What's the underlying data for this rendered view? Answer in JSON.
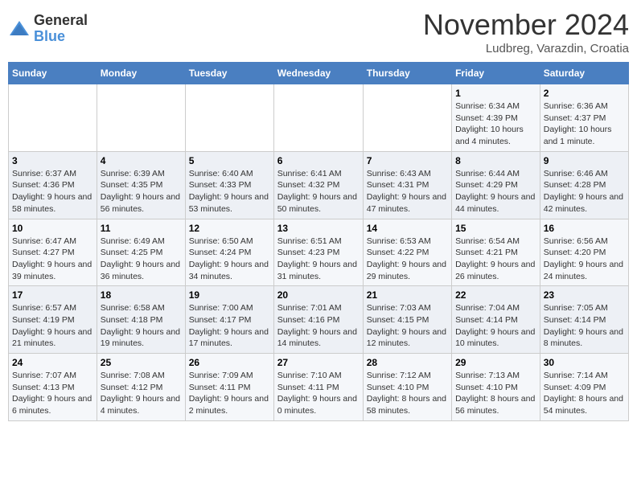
{
  "logo": {
    "general": "General",
    "blue": "Blue"
  },
  "title": "November 2024",
  "location": "Ludbreg, Varazdin, Croatia",
  "days_header": [
    "Sunday",
    "Monday",
    "Tuesday",
    "Wednesday",
    "Thursday",
    "Friday",
    "Saturday"
  ],
  "weeks": [
    [
      {
        "day": "",
        "detail": ""
      },
      {
        "day": "",
        "detail": ""
      },
      {
        "day": "",
        "detail": ""
      },
      {
        "day": "",
        "detail": ""
      },
      {
        "day": "",
        "detail": ""
      },
      {
        "day": "1",
        "detail": "Sunrise: 6:34 AM\nSunset: 4:39 PM\nDaylight: 10 hours and 4 minutes."
      },
      {
        "day": "2",
        "detail": "Sunrise: 6:36 AM\nSunset: 4:37 PM\nDaylight: 10 hours and 1 minute."
      }
    ],
    [
      {
        "day": "3",
        "detail": "Sunrise: 6:37 AM\nSunset: 4:36 PM\nDaylight: 9 hours and 58 minutes."
      },
      {
        "day": "4",
        "detail": "Sunrise: 6:39 AM\nSunset: 4:35 PM\nDaylight: 9 hours and 56 minutes."
      },
      {
        "day": "5",
        "detail": "Sunrise: 6:40 AM\nSunset: 4:33 PM\nDaylight: 9 hours and 53 minutes."
      },
      {
        "day": "6",
        "detail": "Sunrise: 6:41 AM\nSunset: 4:32 PM\nDaylight: 9 hours and 50 minutes."
      },
      {
        "day": "7",
        "detail": "Sunrise: 6:43 AM\nSunset: 4:31 PM\nDaylight: 9 hours and 47 minutes."
      },
      {
        "day": "8",
        "detail": "Sunrise: 6:44 AM\nSunset: 4:29 PM\nDaylight: 9 hours and 44 minutes."
      },
      {
        "day": "9",
        "detail": "Sunrise: 6:46 AM\nSunset: 4:28 PM\nDaylight: 9 hours and 42 minutes."
      }
    ],
    [
      {
        "day": "10",
        "detail": "Sunrise: 6:47 AM\nSunset: 4:27 PM\nDaylight: 9 hours and 39 minutes."
      },
      {
        "day": "11",
        "detail": "Sunrise: 6:49 AM\nSunset: 4:25 PM\nDaylight: 9 hours and 36 minutes."
      },
      {
        "day": "12",
        "detail": "Sunrise: 6:50 AM\nSunset: 4:24 PM\nDaylight: 9 hours and 34 minutes."
      },
      {
        "day": "13",
        "detail": "Sunrise: 6:51 AM\nSunset: 4:23 PM\nDaylight: 9 hours and 31 minutes."
      },
      {
        "day": "14",
        "detail": "Sunrise: 6:53 AM\nSunset: 4:22 PM\nDaylight: 9 hours and 29 minutes."
      },
      {
        "day": "15",
        "detail": "Sunrise: 6:54 AM\nSunset: 4:21 PM\nDaylight: 9 hours and 26 minutes."
      },
      {
        "day": "16",
        "detail": "Sunrise: 6:56 AM\nSunset: 4:20 PM\nDaylight: 9 hours and 24 minutes."
      }
    ],
    [
      {
        "day": "17",
        "detail": "Sunrise: 6:57 AM\nSunset: 4:19 PM\nDaylight: 9 hours and 21 minutes."
      },
      {
        "day": "18",
        "detail": "Sunrise: 6:58 AM\nSunset: 4:18 PM\nDaylight: 9 hours and 19 minutes."
      },
      {
        "day": "19",
        "detail": "Sunrise: 7:00 AM\nSunset: 4:17 PM\nDaylight: 9 hours and 17 minutes."
      },
      {
        "day": "20",
        "detail": "Sunrise: 7:01 AM\nSunset: 4:16 PM\nDaylight: 9 hours and 14 minutes."
      },
      {
        "day": "21",
        "detail": "Sunrise: 7:03 AM\nSunset: 4:15 PM\nDaylight: 9 hours and 12 minutes."
      },
      {
        "day": "22",
        "detail": "Sunrise: 7:04 AM\nSunset: 4:14 PM\nDaylight: 9 hours and 10 minutes."
      },
      {
        "day": "23",
        "detail": "Sunrise: 7:05 AM\nSunset: 4:14 PM\nDaylight: 9 hours and 8 minutes."
      }
    ],
    [
      {
        "day": "24",
        "detail": "Sunrise: 7:07 AM\nSunset: 4:13 PM\nDaylight: 9 hours and 6 minutes."
      },
      {
        "day": "25",
        "detail": "Sunrise: 7:08 AM\nSunset: 4:12 PM\nDaylight: 9 hours and 4 minutes."
      },
      {
        "day": "26",
        "detail": "Sunrise: 7:09 AM\nSunset: 4:11 PM\nDaylight: 9 hours and 2 minutes."
      },
      {
        "day": "27",
        "detail": "Sunrise: 7:10 AM\nSunset: 4:11 PM\nDaylight: 9 hours and 0 minutes."
      },
      {
        "day": "28",
        "detail": "Sunrise: 7:12 AM\nSunset: 4:10 PM\nDaylight: 8 hours and 58 minutes."
      },
      {
        "day": "29",
        "detail": "Sunrise: 7:13 AM\nSunset: 4:10 PM\nDaylight: 8 hours and 56 minutes."
      },
      {
        "day": "30",
        "detail": "Sunrise: 7:14 AM\nSunset: 4:09 PM\nDaylight: 8 hours and 54 minutes."
      }
    ]
  ]
}
